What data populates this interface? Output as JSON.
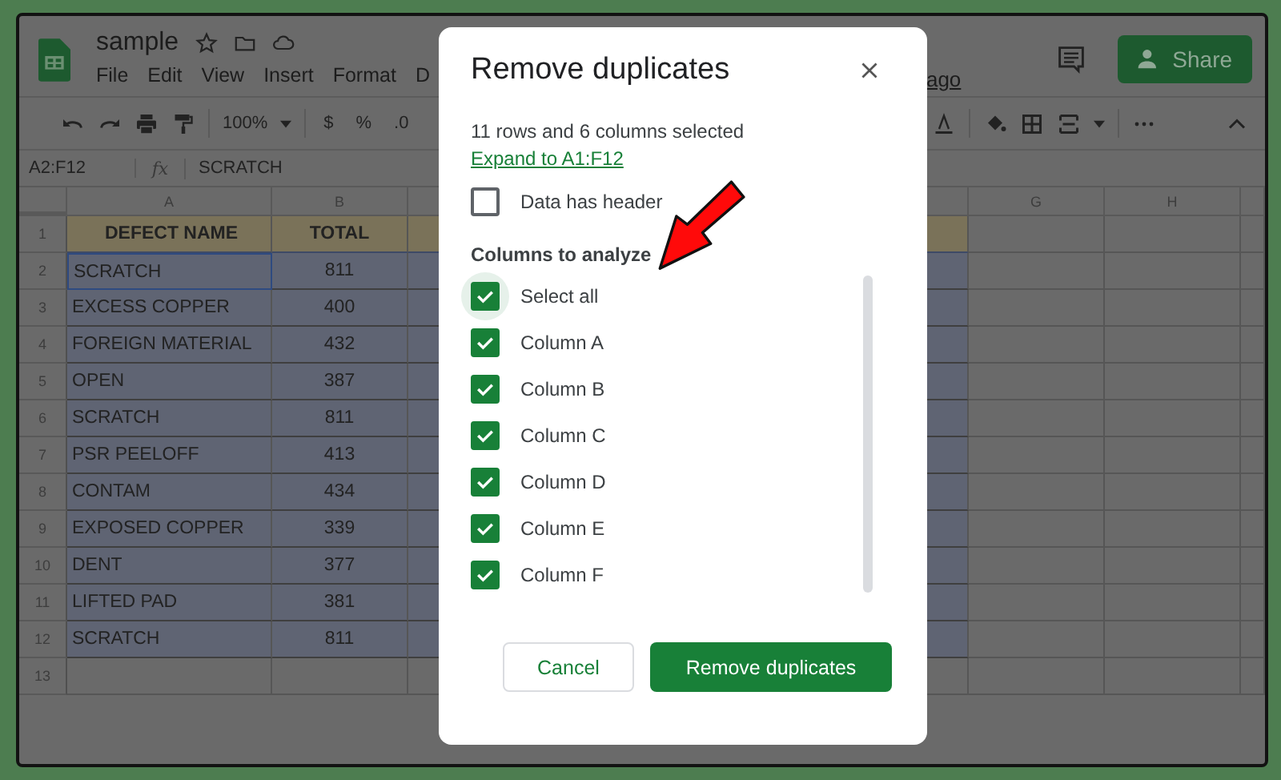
{
  "app": {
    "doc_title": "sample",
    "menu": [
      "File",
      "Edit",
      "View",
      "Insert",
      "Format",
      "D"
    ],
    "last_edit": "ago",
    "share": "Share",
    "zoom": "100%",
    "toolbar_symbols": [
      "$",
      "%",
      ".0"
    ]
  },
  "formula_bar": {
    "cell_ref": "A2:F12",
    "fx": "fx",
    "formula": "SCRATCH"
  },
  "sheet": {
    "columns": [
      "A",
      "B",
      "G",
      "H"
    ],
    "rows": [
      {
        "num": "1",
        "kind": "header",
        "active": false,
        "name": "DEFECT NAME",
        "total": "TOTAL"
      },
      {
        "num": "2",
        "kind": "data",
        "active": true,
        "name": "SCRATCH",
        "total": "811"
      },
      {
        "num": "3",
        "kind": "data",
        "active": false,
        "name": "EXCESS COPPER",
        "total": "400"
      },
      {
        "num": "4",
        "kind": "data",
        "active": false,
        "name": "FOREIGN MATERIAL",
        "total": "432"
      },
      {
        "num": "5",
        "kind": "data",
        "active": false,
        "name": "OPEN",
        "total": "387"
      },
      {
        "num": "6",
        "kind": "data",
        "active": false,
        "name": "SCRATCH",
        "total": "811"
      },
      {
        "num": "7",
        "kind": "data",
        "active": false,
        "name": "PSR PEELOFF",
        "total": "413"
      },
      {
        "num": "8",
        "kind": "data",
        "active": false,
        "name": "CONTAM",
        "total": "434"
      },
      {
        "num": "9",
        "kind": "data",
        "active": false,
        "name": "EXPOSED COPPER",
        "total": "339"
      },
      {
        "num": "10",
        "kind": "data",
        "active": false,
        "name": "DENT",
        "total": "377"
      },
      {
        "num": "11",
        "kind": "data",
        "active": false,
        "name": "LIFTED PAD",
        "total": "381"
      },
      {
        "num": "12",
        "kind": "data",
        "active": false,
        "name": "SCRATCH",
        "total": "811"
      },
      {
        "num": "13",
        "kind": "empty",
        "active": false
      }
    ]
  },
  "dialog": {
    "title": "Remove duplicates",
    "summary": "11 rows and 6 columns selected",
    "expand_link": "Expand to A1:F12",
    "header_checkbox": {
      "label": "Data has header",
      "checked": false
    },
    "columns_heading": "Columns to analyze",
    "columns": [
      {
        "label": "Select all",
        "checked": true,
        "focused": true
      },
      {
        "label": "Column A",
        "checked": true,
        "focused": false
      },
      {
        "label": "Column B",
        "checked": true,
        "focused": false
      },
      {
        "label": "Column C",
        "checked": true,
        "focused": false
      },
      {
        "label": "Column D",
        "checked": true,
        "focused": false
      },
      {
        "label": "Column E",
        "checked": true,
        "focused": false
      },
      {
        "label": "Column F",
        "checked": true,
        "focused": false
      }
    ],
    "cancel": "Cancel",
    "confirm": "Remove duplicates"
  }
}
